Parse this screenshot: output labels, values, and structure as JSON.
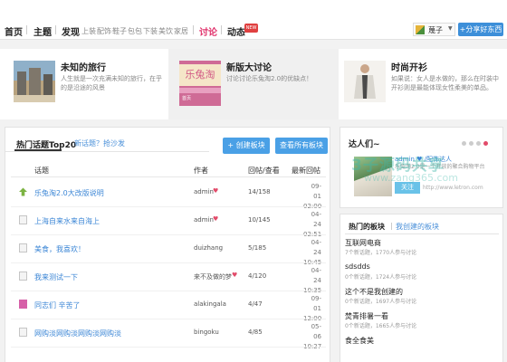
{
  "nav": {
    "home": "首页",
    "topics": "主题",
    "discover": "发现",
    "categories": [
      "上装",
      "配饰",
      "鞋子",
      "包包",
      "下装",
      "美饮",
      "家居"
    ],
    "discuss": "讨论",
    "news": "动态",
    "new_badge": "NEW",
    "user_name": "蔑子",
    "user_caret": "▼",
    "share_button": "+分享好东西"
  },
  "featured": [
    {
      "title": "未知的旅行",
      "desc": "人生就是一次充满未知的旅行，在乎的是沿途的风景"
    },
    {
      "title": "新版大讨论",
      "desc": "讨论讨论乐兔淘2.0的优缺点！",
      "logo": "乐兔淘",
      "logo_sub": "首页"
    },
    {
      "title": "时尚开衫",
      "desc": "如果说：女人是水做的，那么在时装中开衫则是最能体现女性柔美的单品。"
    }
  ],
  "topics": {
    "tab_active": "热门话题Top20",
    "tab_other": "新话题？抢沙发",
    "create_board": "+ 创建板块",
    "view_all": "查看所有板块",
    "headers": {
      "topic": "话题",
      "author": "作者",
      "reply": "回帖/查看",
      "latest": "最新回帖"
    },
    "rows": [
      {
        "icon": "arrow",
        "title": "乐兔淘2.0大改版说明",
        "author": "admin",
        "heart": true,
        "reply": "14/158",
        "date1": "09-01",
        "date2": "02:00"
      },
      {
        "icon": "doc",
        "title": "上海自来水来自海上",
        "author": "admin",
        "heart": true,
        "reply": "10/145",
        "date1": "04-24",
        "date2": "02:51"
      },
      {
        "icon": "doc",
        "title": "美食，我喜欢！",
        "author": "duizhang",
        "heart": false,
        "reply": "5/185",
        "date1": "04-24",
        "date2": "10:45"
      },
      {
        "icon": "doc",
        "title": "我来测试一下",
        "author": "来不及做的梦",
        "heart": true,
        "reply": "4/120",
        "date1": "04-24",
        "date2": "10:35"
      },
      {
        "icon": "tag",
        "title": "同志们 辛苦了",
        "author": "alakingala",
        "heart": false,
        "reply": "4/47",
        "date1": "09-01",
        "date2": "12:00"
      },
      {
        "icon": "doc",
        "title": "网购淡网购淡网购淡网购淡",
        "author": "bingoku",
        "heart": false,
        "reply": "4/85",
        "date1": "05-06",
        "date2": "10:27"
      }
    ]
  },
  "experts": {
    "title": "达人们~",
    "name": "admin ♥ /配饰达人",
    "desc": "乐兔淘2.0是一个开放的聚合购物平台",
    "follow": "关注",
    "url": "http://www.letron.com",
    "watermark": "3子源码共享",
    "watermark2": "www.zang365.com"
  },
  "boards": {
    "tab_hot": "热门的板块",
    "tab_mine": "我创建的板块",
    "items": [
      {
        "name": "互联网电商",
        "meta": "7个新话题，1770人参与讨论"
      },
      {
        "name": "sdsdds",
        "meta": "0个新话题，1724人参与讨论"
      },
      {
        "name": "这个不是我创建的",
        "meta": "0个新话题，1697人参与讨论"
      },
      {
        "name": "焚青排暑一看",
        "meta": "0个新话题，1665人参与讨论"
      },
      {
        "name": "食全食美",
        "meta": ""
      }
    ]
  }
}
